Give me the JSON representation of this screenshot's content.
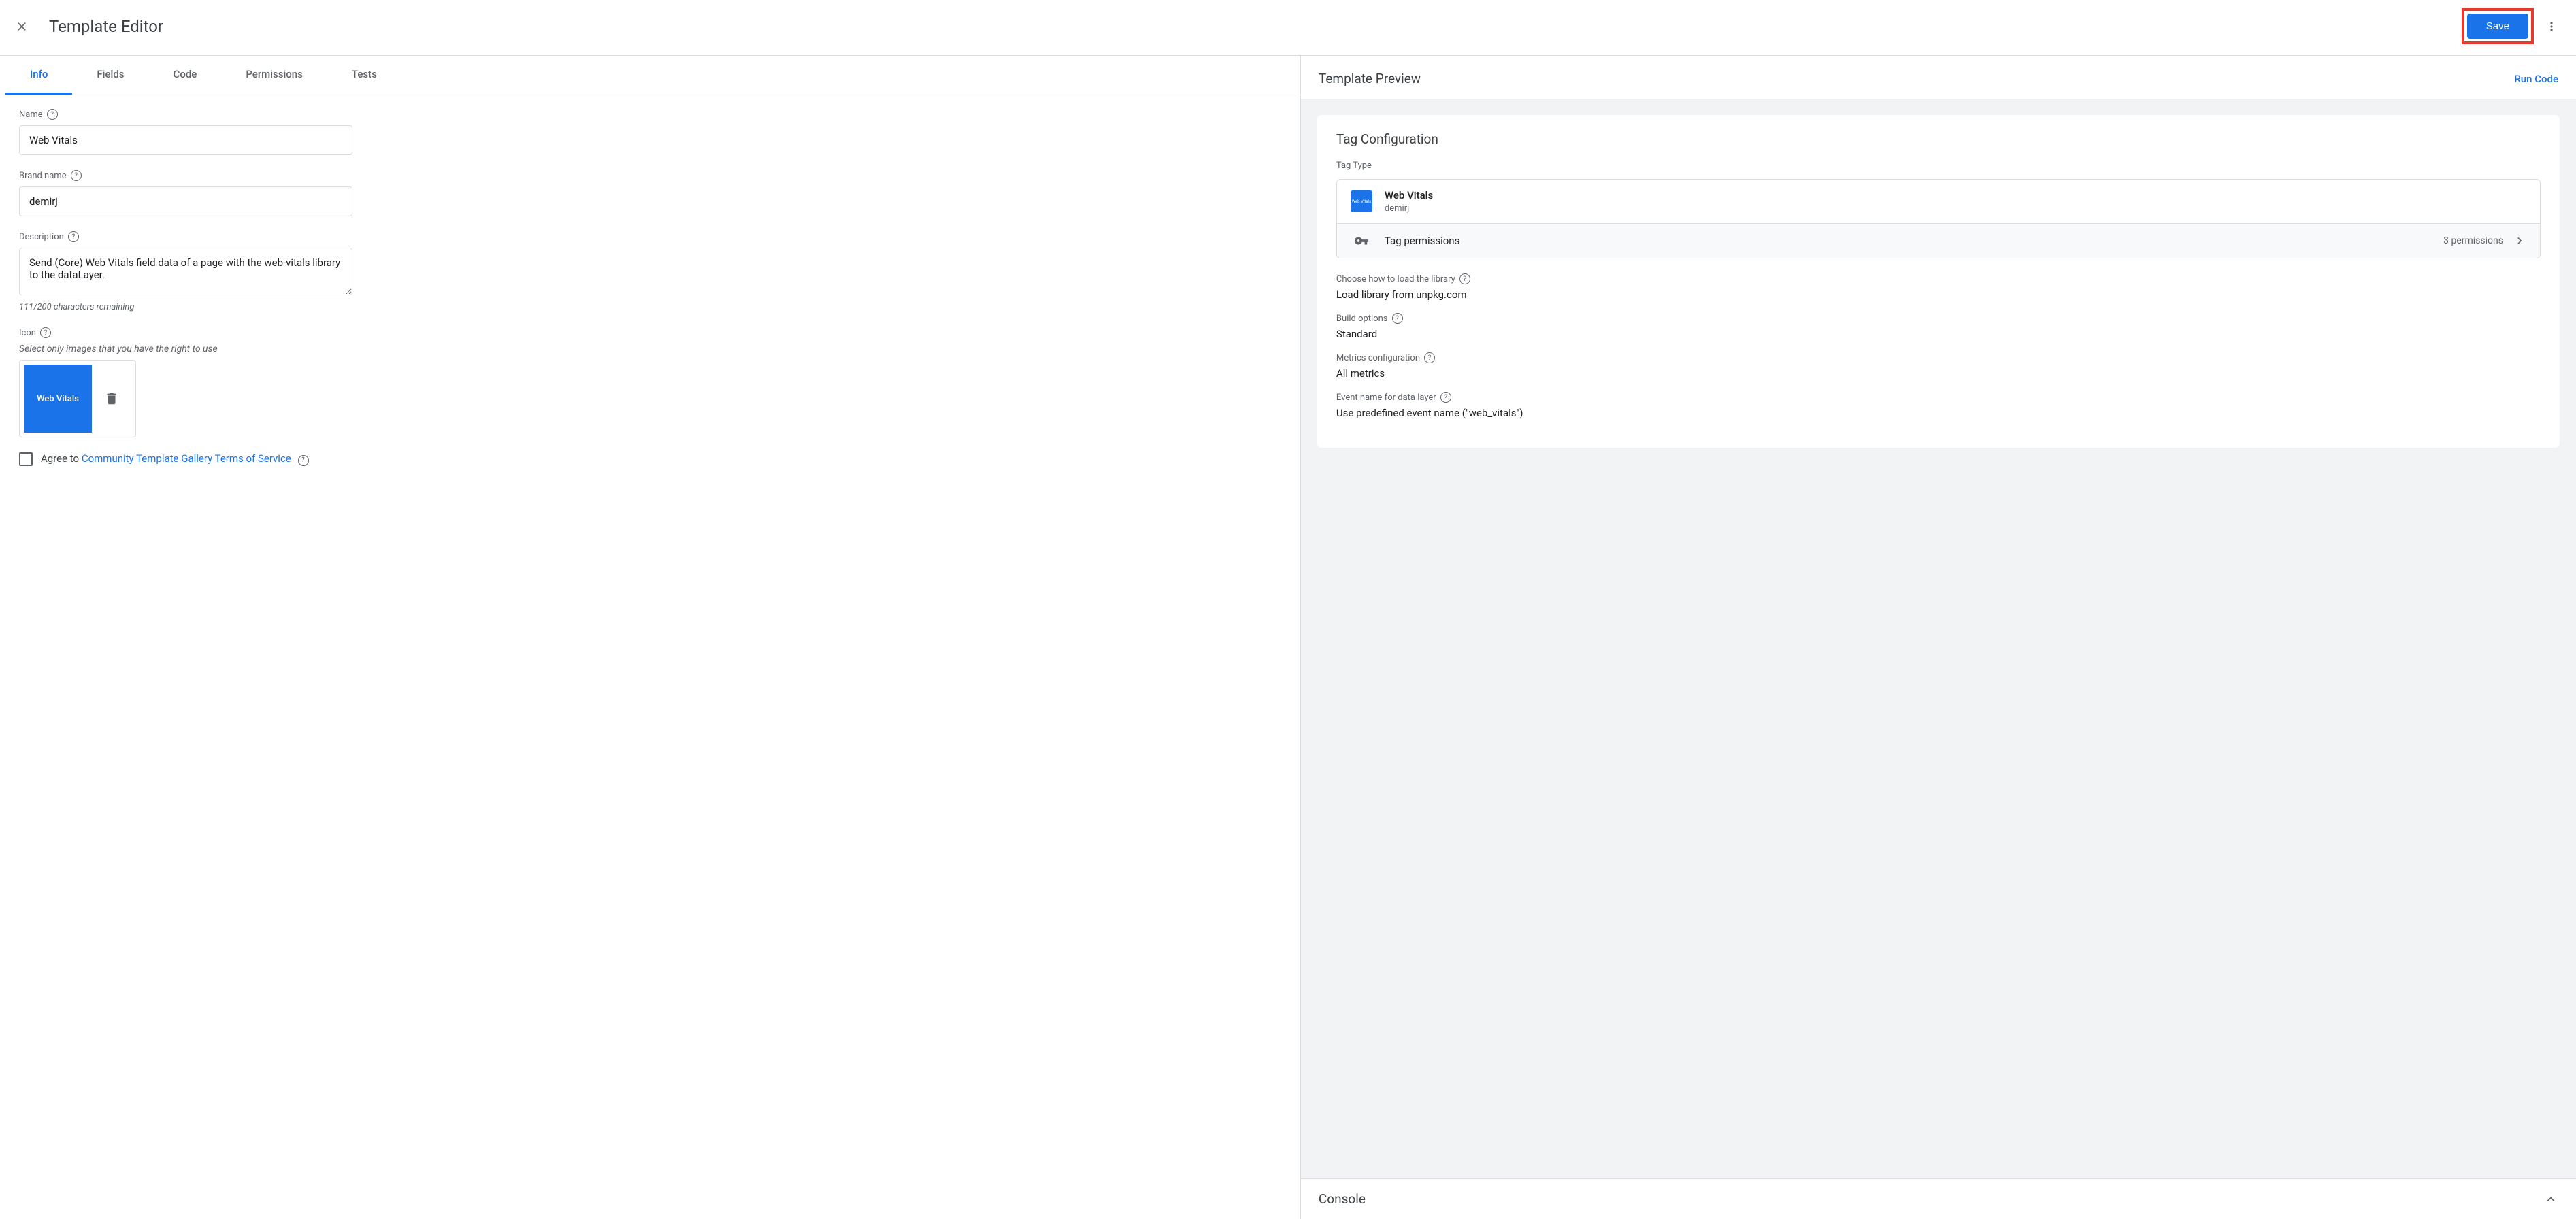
{
  "header": {
    "title": "Template Editor",
    "save_label": "Save"
  },
  "tabs": [
    "Info",
    "Fields",
    "Code",
    "Permissions",
    "Tests"
  ],
  "active_tab": "Info",
  "form": {
    "name_label": "Name",
    "name_value": "Web Vitals",
    "brand_label": "Brand name",
    "brand_value": "demirj",
    "desc_label": "Description",
    "desc_value": "Send (Core) Web Vitals field data of a page with the web-vitals library to the dataLayer.",
    "char_count": "111/200 characters remaining",
    "icon_label": "Icon",
    "icon_hint": "Select only images that you have the right to use",
    "icon_text": "Web Vitals",
    "agree_prefix": "Agree to ",
    "agree_link": "Community Template Gallery Terms of Service"
  },
  "preview": {
    "title": "Template Preview",
    "run_code": "Run Code",
    "card_title": "Tag Configuration",
    "tag_type_label": "Tag Type",
    "tag_name": "Web Vitals",
    "tag_brand": "demirj",
    "tag_icon_text": "Web Vitals",
    "permissions_label": "Tag permissions",
    "permissions_count": "3 permissions",
    "settings": [
      {
        "label": "Choose how to load the library",
        "value": "Load library from unpkg.com",
        "help": true
      },
      {
        "label": "Build options",
        "value": "Standard",
        "help": true
      },
      {
        "label": "Metrics configuration",
        "value": "All metrics",
        "help": true
      },
      {
        "label": "Event name for data layer",
        "value": "Use predefined event name (\"web_vitals\")",
        "help": true
      }
    ],
    "console_label": "Console"
  }
}
